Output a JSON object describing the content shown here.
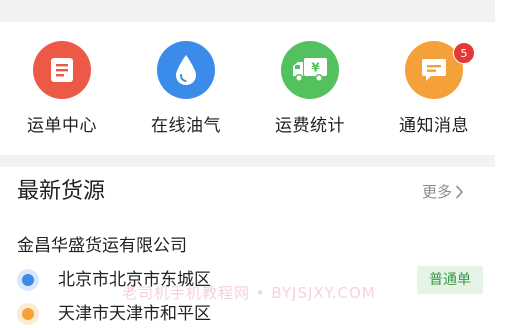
{
  "quick_nav": [
    {
      "label": "运单中心",
      "icon": "waybill-list-icon",
      "color": "#ec5a47"
    },
    {
      "label": "在线油气",
      "icon": "fuel-drop-icon",
      "color": "#3b8bea"
    },
    {
      "label": "运费统计",
      "icon": "freight-truck-icon",
      "color": "#53c15e"
    },
    {
      "label": "通知消息",
      "icon": "message-icon",
      "color": "#f5a13a",
      "badge": "5"
    }
  ],
  "latest": {
    "title": "最新货源",
    "more": "更多",
    "company": "金昌华盛货运有限公司",
    "origin": "北京市北京市东城区",
    "destination": "天津市天津市和平区",
    "tag": "普通单"
  },
  "watermark": "老司机手机教程网 • BYJSJXY.COM",
  "colors": {
    "badge": "#e53935",
    "origin_dot": "#3b8bea",
    "destination_dot": "#f5a13a",
    "tag_text": "#3c9a46",
    "tag_bg": "#e6f4e7"
  }
}
